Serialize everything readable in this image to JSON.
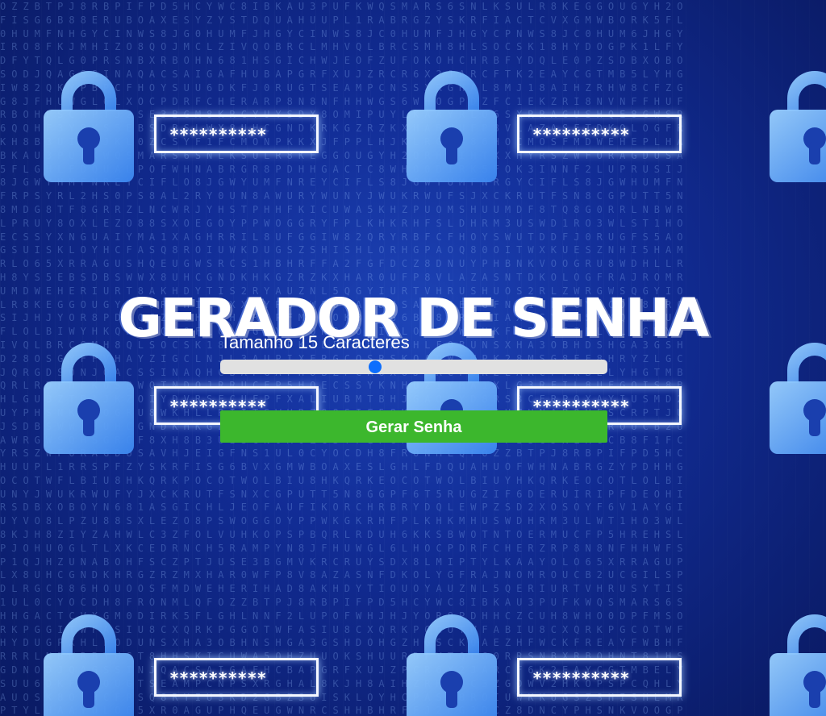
{
  "background": {
    "masked_password": "**********",
    "accent_color": "#3f8cff",
    "lock_icon": "padlock-icon"
  },
  "header": {
    "title": "GERADOR DE SENHA"
  },
  "controls": {
    "size_label": "Tamanho 15 Caracteres",
    "slider_value_fraction": 0.4,
    "button_label": "Gerar Senha",
    "button_color": "#3cb72d",
    "slider_color": "#0d6efd"
  }
}
